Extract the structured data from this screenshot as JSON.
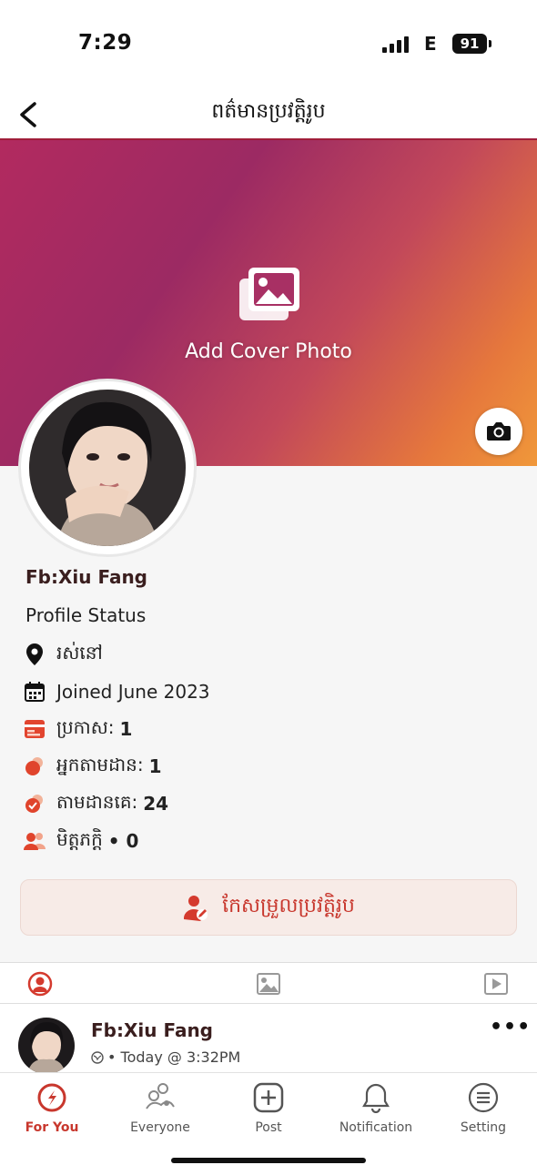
{
  "status_bar": {
    "time": "7:29",
    "network": "E",
    "battery": "91"
  },
  "header": {
    "title": "ពត៌មានប្រវត្តិរូប",
    "back_icon": "chevron-left-icon"
  },
  "cover": {
    "add_cover_label": "Add Cover Photo",
    "gradient": [
      "#b22a5f",
      "#9c2a63",
      "#e6783c",
      "#f0983a"
    ]
  },
  "profile": {
    "name": "Fb:Xiu Fang",
    "status": "Profile Status",
    "location_label": "រស់នៅ",
    "joined": "Joined June 2023",
    "posts_label": "ប្រកាស:",
    "posts_count": "1",
    "followers_label": "អ្នកតាមដាន:",
    "followers_count": "1",
    "following_label": "តាមដានគេ:",
    "following_count": "24",
    "friends_label": "មិត្តភក្តិ",
    "friends_count": "• 0"
  },
  "edit_button": {
    "label": "កែសម្រួលប្រវត្តិរូប"
  },
  "tabs": [
    {
      "name": "profile-tab",
      "icon": "user-circle-icon",
      "active": true
    },
    {
      "name": "photos-tab",
      "icon": "image-icon",
      "active": false
    },
    {
      "name": "videos-tab",
      "icon": "play-icon",
      "active": false
    }
  ],
  "post": {
    "author": "Fb:Xiu Fang",
    "time": "• Today @ 3:32PM",
    "more": "•••"
  },
  "bottom_nav": {
    "for_you": "For You",
    "everyone": "Everyone",
    "post": "Post",
    "notification": "Notification",
    "setting": "Setting"
  },
  "colors": {
    "accent": "#c8372d",
    "name_color": "#3a1e1e"
  }
}
